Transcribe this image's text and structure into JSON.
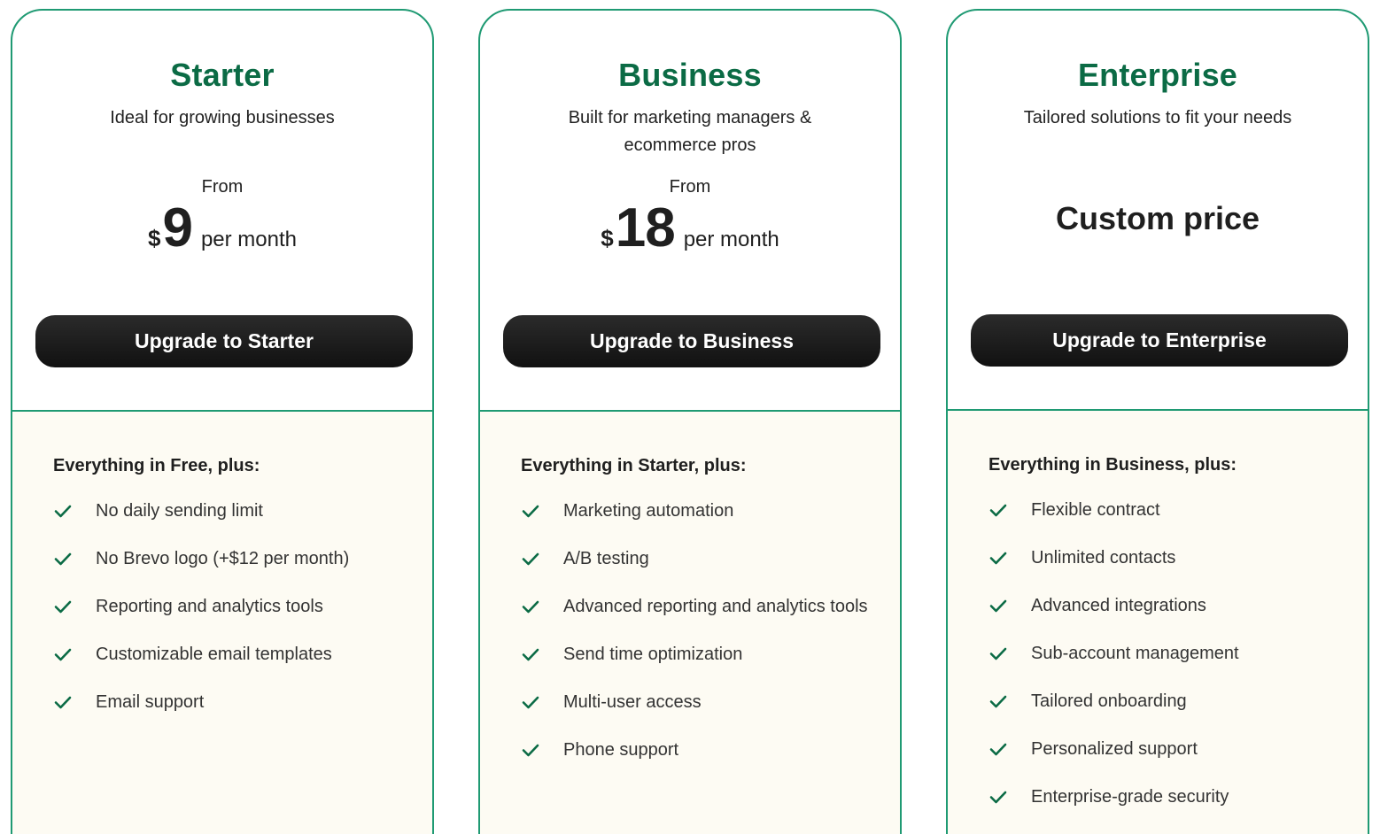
{
  "plans": [
    {
      "name": "Starter",
      "description": "Ideal for growing businesses",
      "from_label": "From",
      "currency": "$",
      "amount": "9",
      "period": "per month",
      "cta": "Upgrade to Starter",
      "features_heading": "Everything in Free, plus:",
      "features": [
        "No daily sending limit",
        "No Brevo logo (+$12 per month)",
        "Reporting and analytics tools",
        "Customizable email templates",
        "Email support"
      ]
    },
    {
      "name": "Business",
      "description": "Built for marketing managers & ecommerce pros",
      "from_label": "From",
      "currency": "$",
      "amount": "18",
      "period": "per month",
      "cta": "Upgrade to Business",
      "features_heading": "Everything in Starter, plus:",
      "features": [
        "Marketing automation",
        "A/B testing",
        "Advanced reporting and analytics tools",
        "Send time optimization",
        "Multi-user access",
        "Phone support"
      ]
    },
    {
      "name": "Enterprise",
      "description": "Tailored solutions to fit your needs",
      "custom_price": "Custom price",
      "cta": "Upgrade to Enterprise",
      "features_heading": "Everything in Business, plus:",
      "features": [
        "Flexible contract",
        "Unlimited contacts",
        "Advanced integrations",
        "Sub-account management",
        "Tailored onboarding",
        "Personalized support",
        "Enterprise-grade security"
      ]
    }
  ],
  "icons": {
    "feature_check": "check-icon"
  },
  "colors": {
    "accent": "#1f9a73",
    "plan_name": "#0b6b45",
    "button": "#1a1a1a",
    "feature_bg": "#fdfbf3"
  }
}
